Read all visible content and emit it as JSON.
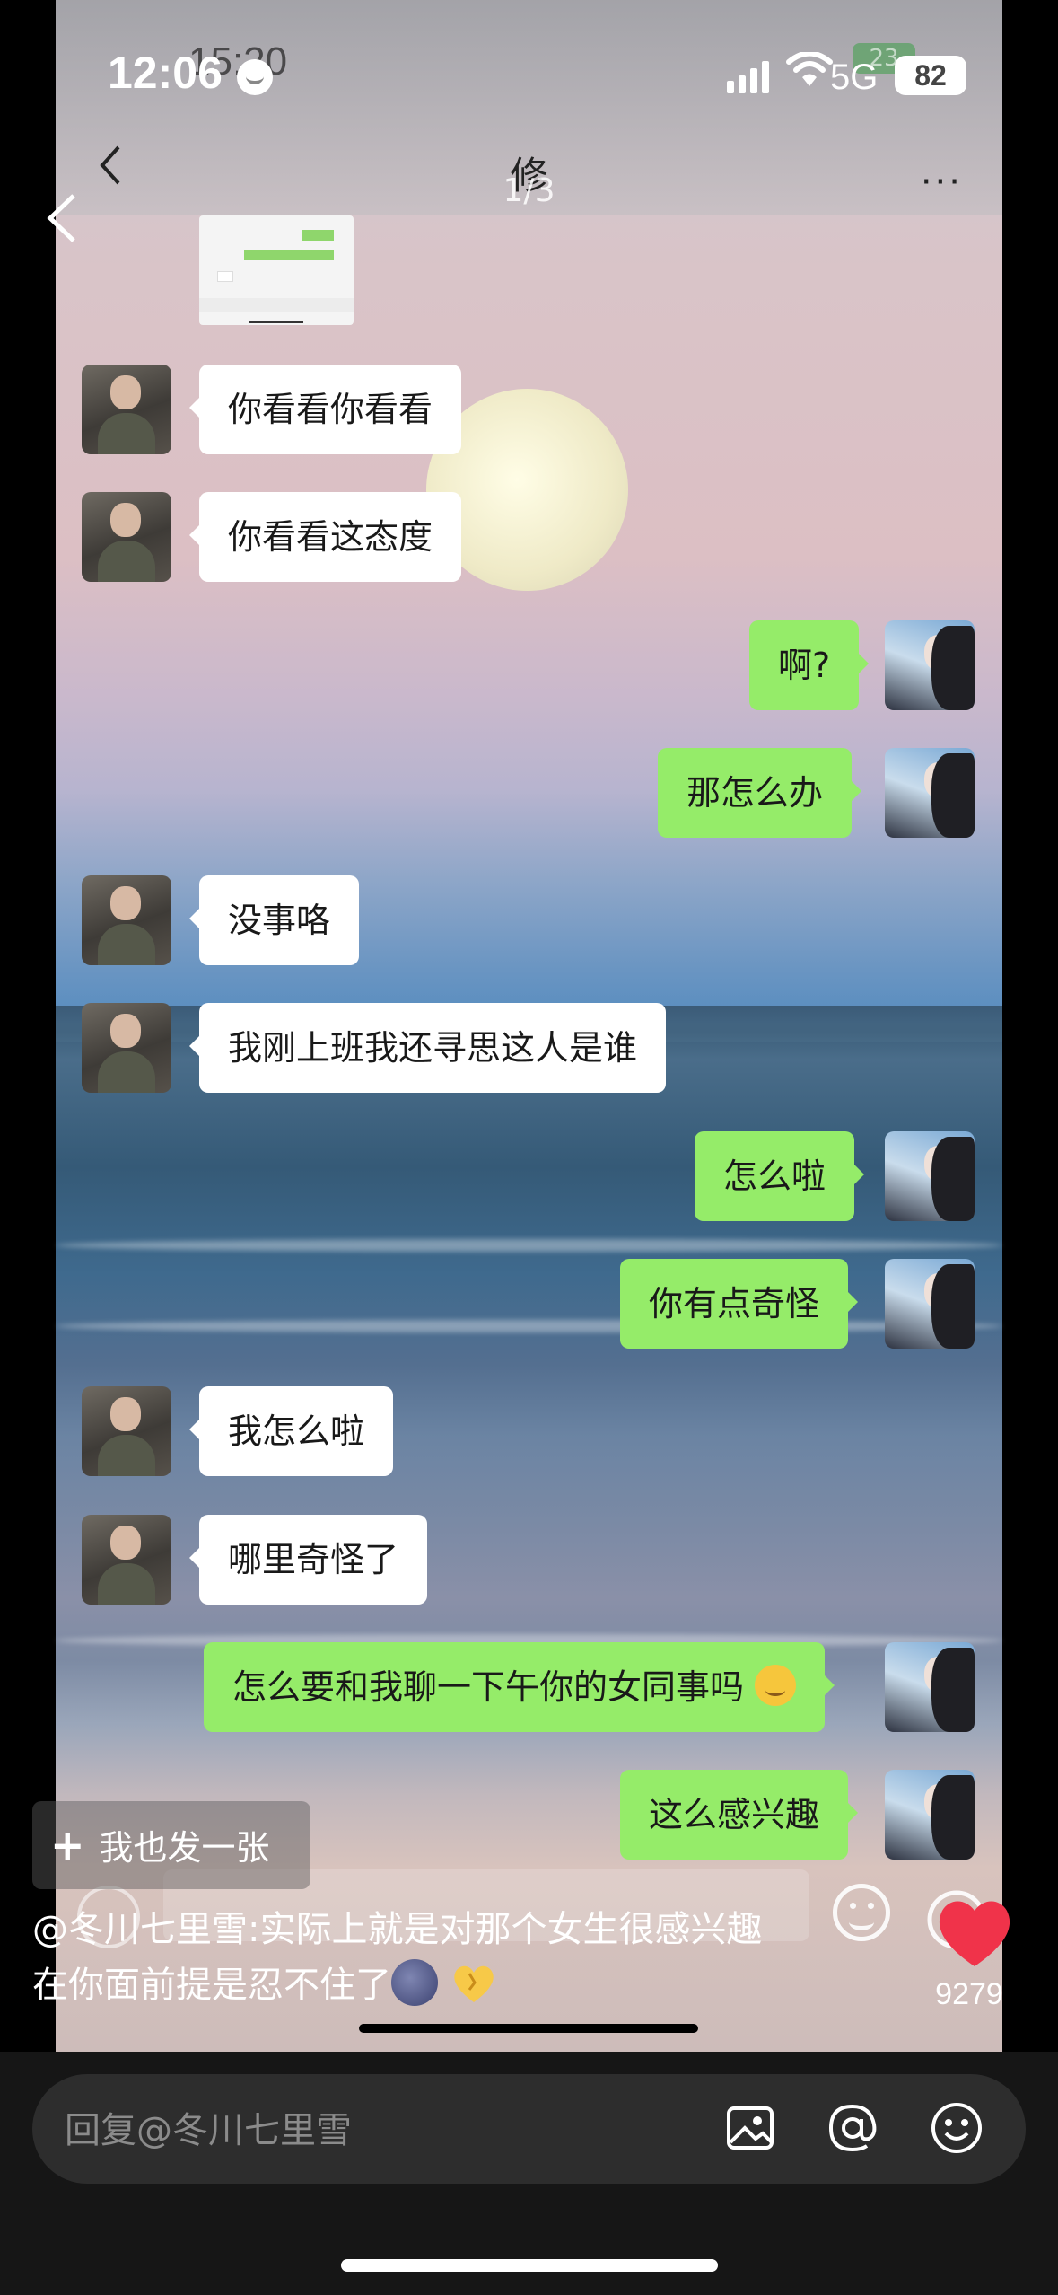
{
  "status_bar": {
    "time": "12:06",
    "ghost_time": "15:20",
    "network": "5G",
    "battery": "82",
    "ghost_battery": "23"
  },
  "chat": {
    "title": "修",
    "page_indicator": "1/3",
    "more": "···",
    "messages": [
      {
        "side": "left",
        "text": "你看看你看看"
      },
      {
        "side": "left",
        "text": "你看看这态度"
      },
      {
        "side": "right",
        "text": "啊?"
      },
      {
        "side": "right",
        "text": "那怎么办"
      },
      {
        "side": "left",
        "text": "没事咯"
      },
      {
        "side": "left",
        "text": "我刚上班我还寻思这人是谁"
      },
      {
        "side": "right",
        "text": "怎么啦"
      },
      {
        "side": "right",
        "text": "你有点奇怪"
      },
      {
        "side": "left",
        "text": "我怎么啦"
      },
      {
        "side": "left",
        "text": "哪里奇怪了"
      },
      {
        "side": "right",
        "text": "怎么要和我聊一下午你的女同事吗"
      },
      {
        "side": "right",
        "text": "这么感兴趣"
      }
    ]
  },
  "post_button": {
    "label": "我也发一张"
  },
  "comment": {
    "line1": "@冬川七里雪:实际上就是对那个女生很感兴趣",
    "line2": "在你面前提是忍不住了"
  },
  "likes": {
    "count": "9279"
  },
  "reply_input": {
    "placeholder": "回复@冬川七里雪"
  },
  "icons": {
    "back": "chevron-left-icon",
    "more": "more-dots-icon",
    "image": "image-icon",
    "mention": "at-icon",
    "emoji": "smiley-icon",
    "like": "heart-icon"
  },
  "colors": {
    "green_bubble": "#95ec69",
    "white_bubble": "#ffffff",
    "like_heart": "#f0334a",
    "bottom_bar": "#161616"
  }
}
